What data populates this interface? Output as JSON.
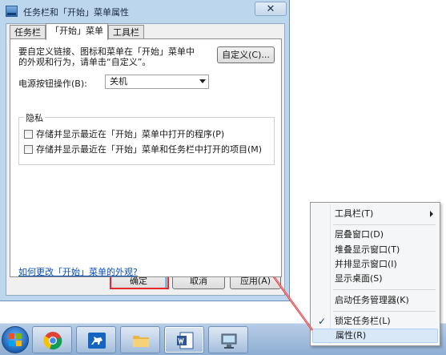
{
  "window": {
    "title": "任务栏和「开始」菜单属性",
    "close_glyph": "✕"
  },
  "tabs": [
    {
      "label": "任务栏",
      "active": false
    },
    {
      "label": "「开始」菜单",
      "active": true
    },
    {
      "label": "工具栏",
      "active": false
    }
  ],
  "start_menu_tab": {
    "description": "要自定义链接、图标和菜单在「开始」菜单中的外观和行为，请单击“自定义”。",
    "customize_button": "自定义(C)...",
    "power_button_label": "电源按钮操作(B):",
    "power_button_value": "关机",
    "privacy": {
      "title": "隐私",
      "options": [
        {
          "label": "存储并显示最近在「开始」菜单中打开的程序(P)",
          "checked": false
        },
        {
          "label": "存储并显示最近在「开始」菜单和任务栏中打开的项目(M)",
          "checked": false
        }
      ]
    },
    "appearance_link": "如何更改「开始」菜单的外观?"
  },
  "buttons": {
    "ok": "确定",
    "cancel": "取消",
    "apply": "应用(A)"
  },
  "context_menu": {
    "items": [
      {
        "label": "工具栏(T)",
        "has_submenu": true
      },
      {
        "label": "层叠窗口(D)"
      },
      {
        "label": "堆叠显示窗口(T)"
      },
      {
        "label": "并排显示窗口(I)"
      },
      {
        "label": "显示桌面(S)"
      },
      {
        "label": "启动任务管理器(K)"
      },
      {
        "label": "锁定任务栏(L)",
        "checked": true
      },
      {
        "label": "属性(R)",
        "selected": true
      }
    ],
    "check_glyph": "✓"
  },
  "taskbar": {
    "items": [
      {
        "icon": "chrome-icon"
      },
      {
        "icon": "horse-app-icon"
      },
      {
        "icon": "folder-icon"
      },
      {
        "icon": "word-icon"
      },
      {
        "icon": "computer-icon"
      }
    ]
  },
  "colors": {
    "annotation_red": "#e5282b",
    "link_blue": "#0a4fb5",
    "window_frame": "#bcd6ee",
    "taskbar": "#8eaed3"
  }
}
